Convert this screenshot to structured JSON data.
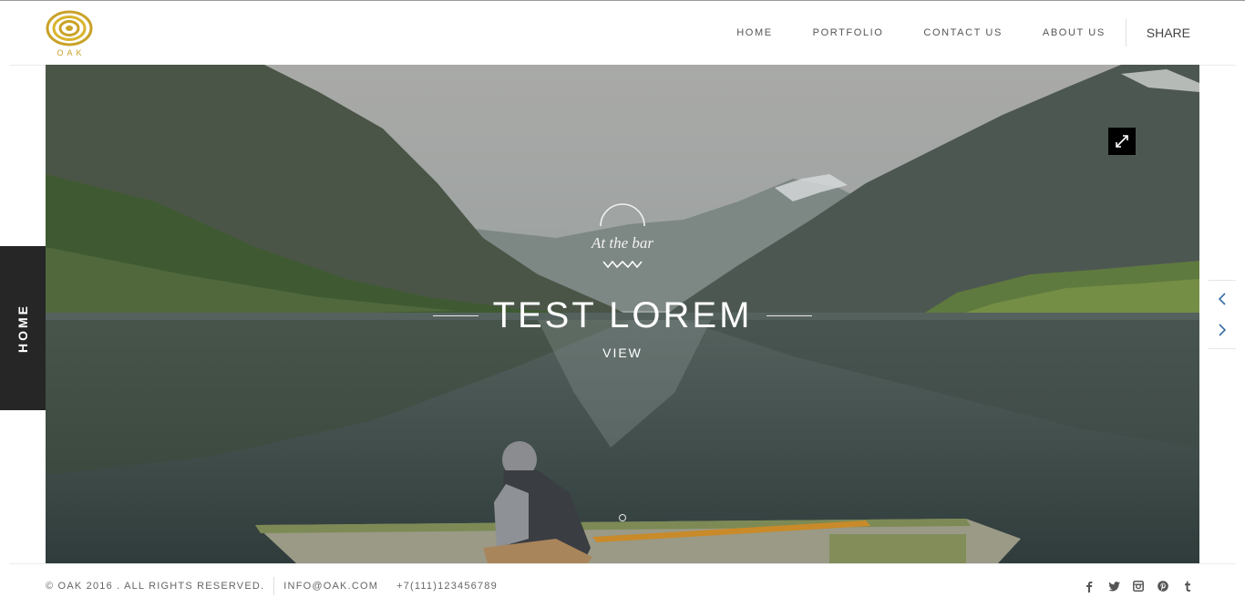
{
  "brand": {
    "name": "OAK",
    "color": "#c9a227"
  },
  "nav": {
    "items": [
      {
        "label": "HOME"
      },
      {
        "label": "PORTFOLIO"
      },
      {
        "label": "CONTACT US"
      },
      {
        "label": "ABOUT US"
      }
    ],
    "share_label": "SHARE"
  },
  "side_tab": {
    "label": "HOME"
  },
  "hero": {
    "subtitle": "At the bar",
    "title": "TEST LOREM",
    "cta": "VIEW",
    "expand_icon": "expand-icon",
    "slide_indicator_icon": "circle-dot-icon"
  },
  "slider_controls": {
    "prev_icon": "chevron-left-icon",
    "next_icon": "chevron-right-icon"
  },
  "footer": {
    "copyright": "© OAK 2016 . ALL RIGHTS RESERVED.",
    "email": "INFO@OAK.COM",
    "phone": "+7(111)123456789",
    "social_icons": [
      "facebook-icon",
      "twitter-icon",
      "instagram-icon",
      "pinterest-icon",
      "tumblr-icon"
    ]
  },
  "colors": {
    "accent": "#c9a227",
    "side_tab_bg": "#262626",
    "arrow": "#3a6ea5"
  }
}
